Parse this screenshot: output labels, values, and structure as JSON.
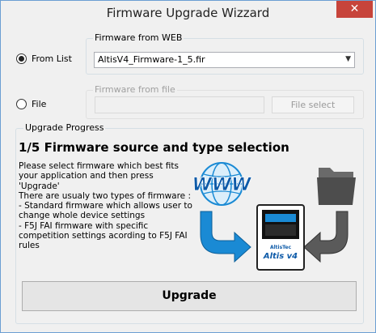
{
  "window": {
    "title": "Firmware Upgrade Wizzard",
    "close_glyph": "✕"
  },
  "source": {
    "from_list_label": "From List",
    "from_list_selected": true,
    "web_group_label": "Firmware from WEB",
    "web_selected_value": "AltisV4_Firmware-1_5.fir",
    "file_label": "File",
    "file_selected": false,
    "file_group_label": "Firmware from file",
    "file_path_value": "",
    "file_select_label": "File select"
  },
  "progress": {
    "group_label": "Upgrade Progress",
    "heading": "1/5 Firmware source and type selection",
    "description": "Please select firmware which best fits\nyour application and then press\n'Upgrade'\nThere are usualy two types of firmware :\n- Standard firmware which allows user to\nchange whole device settings\n- F5J FAI firmware with specific\ncompetition settings acording to F5J FAI\nrules",
    "illustration": {
      "www_text": "WWW",
      "device_brand": "AltisTec",
      "device_model": "Altis v4",
      "icons": [
        "www-globe-icon",
        "folder-icon",
        "arrow-down-right-icon",
        "arrow-down-left-icon",
        "altis-device-icon"
      ]
    }
  },
  "actions": {
    "upgrade_label": "Upgrade"
  },
  "colors": {
    "accent_blue": "#1a8ad4",
    "close_red": "#c7443b",
    "folder_gray": "#4d4d4d"
  }
}
